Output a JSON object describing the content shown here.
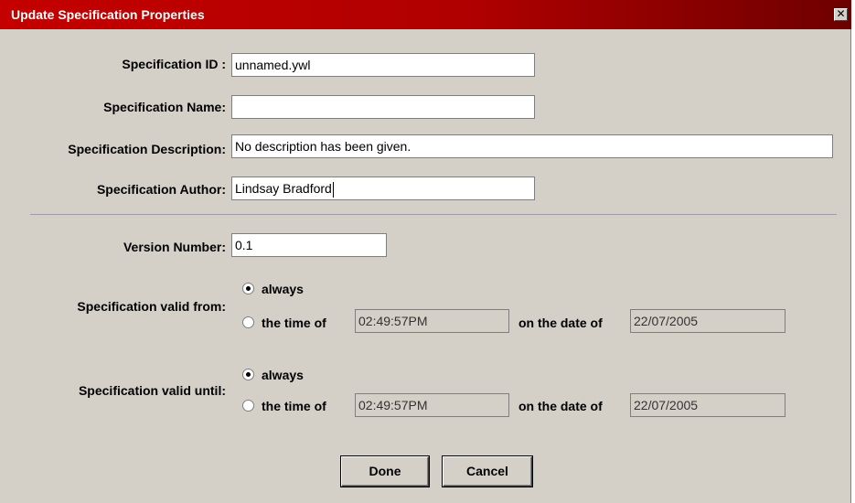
{
  "window": {
    "title": "Update Specification Properties",
    "close_glyph": "✕"
  },
  "form": {
    "spec_id": {
      "label": "Specification ID :",
      "value": "unnamed.ywl"
    },
    "spec_name": {
      "label": "Specification Name:",
      "value": ""
    },
    "spec_description": {
      "label": "Specification Description:",
      "value": "No description has been given."
    },
    "spec_author": {
      "label": "Specification Author:",
      "value": "Lindsay Bradford"
    },
    "version": {
      "label": "Version Number:",
      "value": "0.1"
    }
  },
  "valid_from": {
    "label": "Specification valid from:",
    "always_label": "always",
    "time_of_label": "the time of",
    "time_value": "02:49:57PM",
    "date_of_label": "on the date of",
    "date_value": "22/07/2005",
    "selected": "always"
  },
  "valid_until": {
    "label": "Specification valid until:",
    "always_label": "always",
    "time_of_label": "the time of",
    "time_value": "02:49:57PM",
    "date_of_label": "on the date of",
    "date_value": "22/07/2005",
    "selected": "always"
  },
  "buttons": {
    "done": "Done",
    "cancel": "Cancel"
  },
  "colors": {
    "title_bar_start": "#c40000",
    "title_bar_end": "#6e0000",
    "panel": "#d4d0c8"
  },
  "icons": {
    "close": "close-icon",
    "radio_selected": "radio-selected-icon",
    "radio_unselected": "radio-unselected-icon"
  }
}
